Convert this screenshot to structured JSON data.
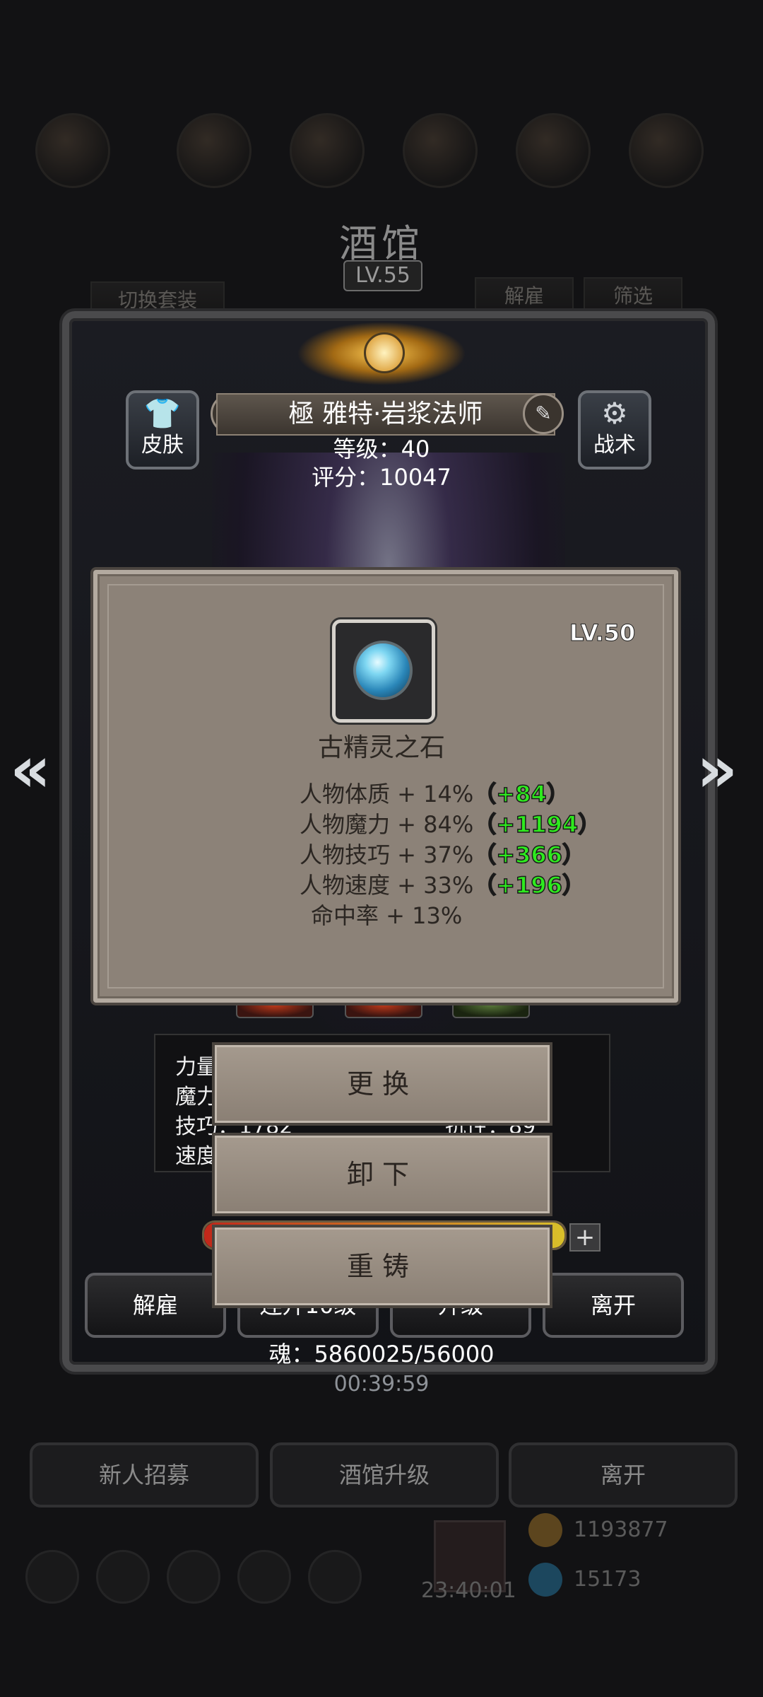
{
  "tavern": {
    "title": "酒馆",
    "level": "LV.55",
    "switch_outfit": "切换套装",
    "dismiss": "解雇",
    "filter": "筛选",
    "recruit": "新人招募",
    "upgrade": "酒馆升级",
    "leave": "离开",
    "gold": "1193877",
    "gems": "15173",
    "clock": "23:40:01"
  },
  "hero": {
    "name": "極 雅特·岩浆法师",
    "level_line": "等级：40",
    "score_line": "评分：10047",
    "skin_label": "皮肤",
    "tactics_label": "战术",
    "info_lines": [
      "力量",
      "魔力",
      "技巧：1782",
      "速度"
    ],
    "info_extra": "抗性：89",
    "bottom_buttons": [
      "解雇",
      "连升10级",
      "升级",
      "离开"
    ],
    "soul": "魂：5860025/56000",
    "timer": "00:39:59"
  },
  "item": {
    "level": "LV.50",
    "name": "古精灵之石",
    "stats": [
      {
        "label": "人物体质 + 14%",
        "bonus": "（+84）"
      },
      {
        "label": "人物魔力 + 84%",
        "bonus": "（+1194）"
      },
      {
        "label": "人物技巧 + 37%",
        "bonus": "（+366）"
      },
      {
        "label": "人物速度 + 33%",
        "bonus": "（+196）"
      },
      {
        "label": "命中率 + 13%",
        "bonus": ""
      }
    ]
  },
  "actions": {
    "replace": "更换",
    "unequip": "卸下",
    "reforge": "重铸"
  },
  "icons": {
    "left_arrow": "double-chevron-left-icon",
    "right_arrow": "double-chevron-right-icon",
    "skin": "shirt-icon",
    "tactics": "gear-icon",
    "edit": "edit-icon",
    "plus": "plus-icon"
  }
}
